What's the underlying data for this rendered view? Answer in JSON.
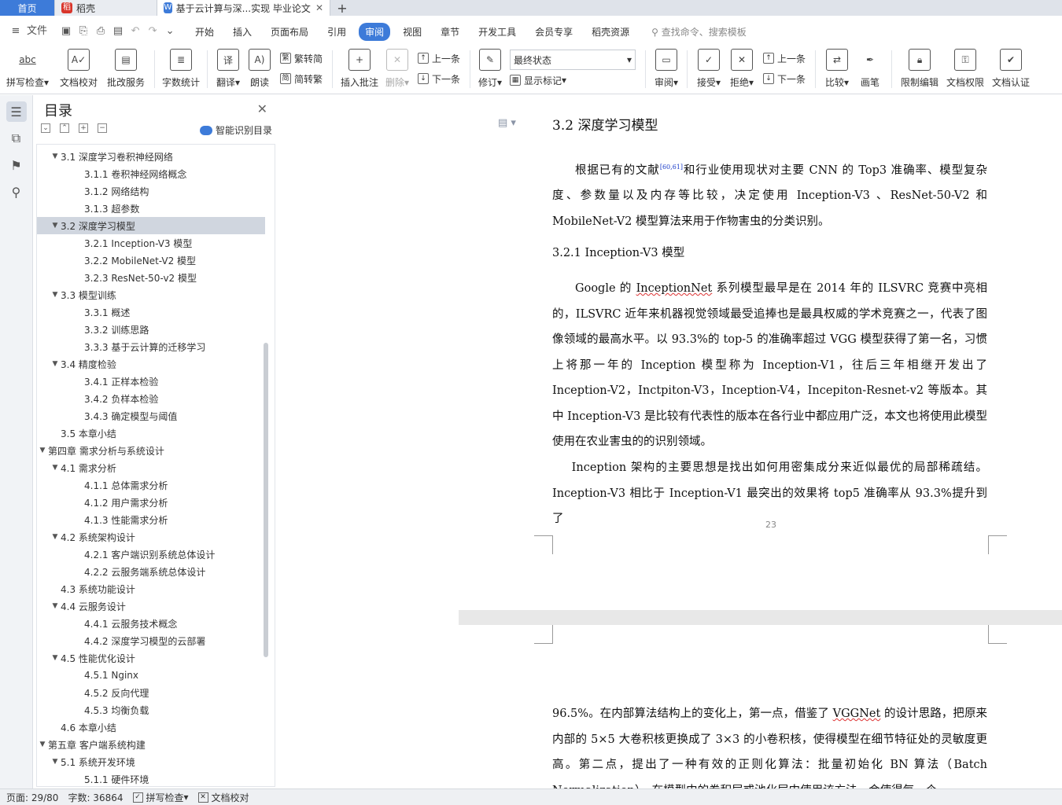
{
  "tabs": {
    "home": "首页",
    "daoke": "稻壳",
    "doc": "基于云计算与深...实现 毕业论文",
    "add": "+"
  },
  "menu": {
    "file": "文件",
    "items": [
      "开始",
      "插入",
      "页面布局",
      "引用",
      "审阅",
      "视图",
      "章节",
      "开发工具",
      "会员专享",
      "稻壳资源"
    ],
    "active": "审阅",
    "search": "查找命令、搜索模板"
  },
  "ribbon": {
    "spell": "拼写检查",
    "abc": "abc",
    "proof": "文档校对",
    "batch": "批改服务",
    "wordcount": "字数统计",
    "translate": "翻译",
    "read": "朗读",
    "trad2simp": "繁转简",
    "simp2trad": "简转繁",
    "insert_comment": "插入批注",
    "delete": "删除",
    "prev": "上一条",
    "next": "下一条",
    "revise": "修订",
    "final_state": "最终状态",
    "show_marks": "显示标记",
    "review": "审阅",
    "accept": "接受",
    "reject": "拒绝",
    "prev2": "上一条",
    "next2": "下一条",
    "compare": "比较",
    "pen": "画笔",
    "restrict": "限制编辑",
    "perm": "文档权限",
    "cert": "文档认证"
  },
  "toc": {
    "title": "目录",
    "smart": "智能识别目录",
    "items": [
      {
        "label": "3.1  深度学习卷积神经网络",
        "level": 2,
        "caret": true
      },
      {
        "label": "3.1.1  卷积神经网络概念",
        "level": 3
      },
      {
        "label": "3.1.2  网络结构",
        "level": 3
      },
      {
        "label": "3.1.3  超参数",
        "level": 3
      },
      {
        "label": "3.2  深度学习模型",
        "level": 2,
        "caret": true,
        "selected": true
      },
      {
        "label": "3.2.1 Inception-V3 模型",
        "level": 3
      },
      {
        "label": "3.2.2 MobileNet-V2 模型",
        "level": 3
      },
      {
        "label": "3.2.3 ResNet-50-v2 模型",
        "level": 3
      },
      {
        "label": "3.3  模型训练",
        "level": 2,
        "caret": true
      },
      {
        "label": "3.3.1  概述",
        "level": 3
      },
      {
        "label": "3.3.2  训练思路",
        "level": 3
      },
      {
        "label": "3.3.3  基于云计算的迁移学习",
        "level": 3
      },
      {
        "label": "3.4  精度检验",
        "level": 2,
        "caret": true
      },
      {
        "label": "3.4.1  正样本检验",
        "level": 3
      },
      {
        "label": "3.4.2  负样本检验",
        "level": 3
      },
      {
        "label": "3.4.3  确定模型与阈值",
        "level": 3
      },
      {
        "label": "3.5  本章小结",
        "level": 2
      },
      {
        "label": "第四章  需求分析与系统设计",
        "level": 1,
        "caret": true
      },
      {
        "label": "4.1  需求分析",
        "level": 2,
        "caret": true
      },
      {
        "label": "4.1.1  总体需求分析",
        "level": 3
      },
      {
        "label": "4.1.2  用户需求分析",
        "level": 3
      },
      {
        "label": "4.1.3  性能需求分析",
        "level": 3
      },
      {
        "label": "4.2  系统架构设计",
        "level": 2,
        "caret": true
      },
      {
        "label": "4.2.1  客户端识别系统总体设计",
        "level": 3
      },
      {
        "label": "4.2.2  云服务端系统总体设计",
        "level": 3
      },
      {
        "label": "4.3  系统功能设计",
        "level": 2
      },
      {
        "label": "4.4  云服务设计",
        "level": 2,
        "caret": true
      },
      {
        "label": "4.4.1  云服务技术概念",
        "level": 3
      },
      {
        "label": "4.4.2 深度学习模型的云部署",
        "level": 3
      },
      {
        "label": "4.5  性能优化设计",
        "level": 2,
        "caret": true
      },
      {
        "label": "4.5.1 Nginx",
        "level": 3
      },
      {
        "label": "4.5.2  反向代理",
        "level": 3
      },
      {
        "label": "4.5.3  均衡负载",
        "level": 3
      },
      {
        "label": "4.6 本章小结",
        "level": 2
      },
      {
        "label": "第五章  客户端系统构建",
        "level": 1,
        "caret": true
      },
      {
        "label": "5.1 系统开发环境",
        "level": 2,
        "caret": true
      },
      {
        "label": "5.1.1  硬件环境",
        "level": 3
      }
    ]
  },
  "doc": {
    "h2": "3.2  深度学习模型",
    "p1_a": "根据已有的文献",
    "p1_ref": "[60,61]",
    "p1_b": "和行业使用现状对主要 CNN 的 Top3 准确率、模型复杂度、参数量以及内存等比较，决定使用 Inception-V3 、ResNet-50-V2 和 MobileNet-V2 模型算法来用于作物害虫的分类识别。",
    "h3": "3.2.1 Inception-V3 模型",
    "p2_a": "Google 的 ",
    "p2_w": "InceptionNet",
    "p2_b": " 系列模型最早是在 2014 年的 ILSVRC 竞赛中亮相的，ILSVRC 近年来机器视觉领域最受追捧也是最具权威的学术竞赛之一，代表了图像领域的最高水平。以 93.3%的 top-5 的准确率超过 VGG 模型获得了第一名，习惯上将那一年的 Inception 模型称为 Inception-V1，往后三年相继开发出了 Inception-V2，Inctpiton-V3，Inception-V4，Incepiton-Resnet-v2 等版本。其中 Inception-V3 是比较有代表性的版本在各行业中都应用广泛，本文也将使用此模型使用在农业害虫的的识别领域。",
    "p3": "Inception 架构的主要思想是找出如何用密集成分来近似最优的局部稀疏结。Inception-V3 相比于 Inception-V1 最突出的效果将 top5 准确率从 93.3%提升到了",
    "page_num": "23",
    "p4_a": "96.5%。在内部算法结构上的变化上，第一点，借鉴了 ",
    "p4_w": "VGGNet",
    "p4_b": " 的设计思路，把原来内部的 5×5 大卷积核更换成了 3×3 的小卷积核，使得模型在细节特征处的灵敏度更高。第二点，提出了一种有效的正则化算法：批量初始化 BN 算法（Batch Normalization），在模型中的卷积层或池化层中使用该方法，会使得每一个"
  },
  "status": {
    "page": "页面: 29/80",
    "words": "字数: 36864",
    "spell": "拼写检查",
    "proof": "文档校对"
  }
}
